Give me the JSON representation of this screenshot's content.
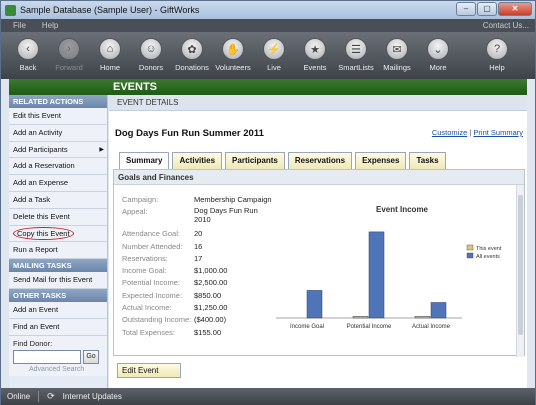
{
  "window": {
    "title": "Sample Database (Sample User) - GiftWorks",
    "min": "–",
    "max": "▢",
    "close": "✕"
  },
  "menu": {
    "file": "File",
    "help": "Help",
    "contact": "Contact Us..."
  },
  "toolbar": [
    {
      "label": "Back",
      "icon": "‹",
      "disabled": false
    },
    {
      "label": "Forward",
      "icon": "›",
      "disabled": true
    },
    {
      "label": "Home",
      "icon": "⌂",
      "disabled": false
    },
    {
      "label": "Donors",
      "icon": "☺",
      "disabled": false
    },
    {
      "label": "Donations",
      "icon": "✿",
      "disabled": false
    },
    {
      "label": "Volunteers",
      "icon": "✋",
      "disabled": false
    },
    {
      "label": "Live",
      "icon": "⚡",
      "disabled": false
    },
    {
      "label": "Events",
      "icon": "★",
      "disabled": false
    },
    {
      "label": "SmartLists",
      "icon": "☰",
      "disabled": false
    },
    {
      "label": "Mailings",
      "icon": "✉",
      "disabled": false
    },
    {
      "label": "More",
      "icon": "⌄",
      "disabled": false
    },
    {
      "label": "Help",
      "icon": "?",
      "disabled": false
    }
  ],
  "banner": {
    "title": "EVENTS"
  },
  "sidebar": {
    "related_actions_title": "RELATED ACTIONS",
    "related_actions": [
      "Edit this Event",
      "Add an Activity",
      "Add Participants",
      "Add a Reservation",
      "Add an Expense",
      "Add a Task",
      "Delete this Event",
      "Copy this Event",
      "Run a Report"
    ],
    "mailing_tasks_title": "MAILING TASKS",
    "mailing_tasks": [
      "Send Mail for this Event"
    ],
    "other_tasks_title": "OTHER TASKS",
    "other_tasks": [
      "Add an Event",
      "Find an Event"
    ],
    "find_donor_label": "Find Donor:",
    "go_label": "Go",
    "advanced_search": "Advanced Search"
  },
  "main": {
    "header": "EVENT DETAILS",
    "event_title": "Dog Days Fun Run Summer 2011",
    "customize": "Customize",
    "link_sep": " | ",
    "print_summary": "Print Summary",
    "tabs": [
      "Summary",
      "Activities",
      "Participants",
      "Reservations",
      "Expenses",
      "Tasks"
    ],
    "section_title": "Goals and Finances",
    "fields": [
      {
        "label": "Campaign:",
        "value": "Membership Campaign"
      },
      {
        "label": "Appeal:",
        "value": "Dog Days Fun Run 2010"
      },
      {
        "label": "Attendance Goal:",
        "value": "20"
      },
      {
        "label": "Number Attended:",
        "value": "16"
      },
      {
        "label": "Reservations:",
        "value": "17"
      },
      {
        "label": "Income Goal:",
        "value": "$1,000.00"
      },
      {
        "label": "Potential Income:",
        "value": "$2,500.00"
      },
      {
        "label": "Expected Income:",
        "value": "$850.00"
      },
      {
        "label": "Actual Income:",
        "value": "$1,250.00"
      },
      {
        "label": "Outstanding Income:",
        "value": "($400.00)"
      },
      {
        "label": "Total Expenses:",
        "value": "$155.00"
      }
    ],
    "edit_button": "Edit Event"
  },
  "chart_data": {
    "type": "bar",
    "title": "Event Income",
    "categories": [
      "Income Goal",
      "Potential Income",
      "Actual Income"
    ],
    "series": [
      {
        "name": "This event",
        "color": "#e6c27a",
        "values": [
          0,
          0.5,
          0.5
        ]
      },
      {
        "name": "All events",
        "color": "#4f74b8",
        "values": [
          8,
          25,
          4.5
        ]
      }
    ],
    "ylim": [
      0,
      27
    ]
  },
  "status": {
    "online": "Online",
    "updates": "Internet Updates"
  }
}
